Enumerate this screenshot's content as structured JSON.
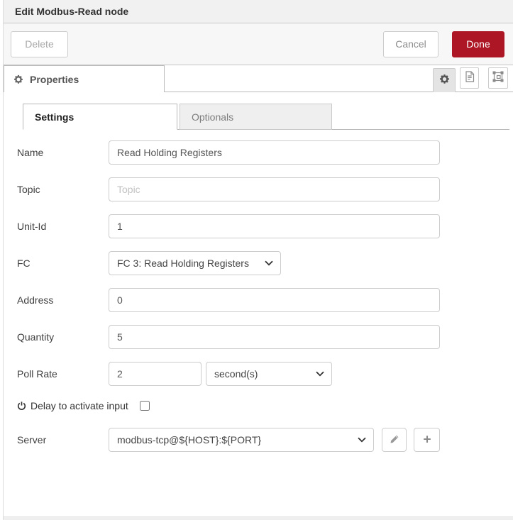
{
  "dialog": {
    "title": "Edit Modbus-Read node"
  },
  "toolbar": {
    "delete_label": "Delete",
    "cancel_label": "Cancel",
    "done_label": "Done"
  },
  "editor_tabs": {
    "properties_label": "Properties",
    "icon_tabs": [
      "gear-icon",
      "document-icon",
      "appearance-icon"
    ]
  },
  "subtabs": {
    "settings_label": "Settings",
    "optionals_label": "Optionals"
  },
  "form": {
    "name": {
      "label": "Name",
      "value": "Read Holding Registers"
    },
    "topic": {
      "label": "Topic",
      "placeholder": "Topic"
    },
    "unit_id": {
      "label": "Unit-Id",
      "value": "1"
    },
    "fc": {
      "label": "FC",
      "value": "FC 3: Read Holding Registers"
    },
    "address": {
      "label": "Address",
      "value": "0"
    },
    "quantity": {
      "label": "Quantity",
      "value": "5"
    },
    "poll_rate": {
      "label": "Poll Rate",
      "value": "2",
      "unit_value": "second(s)"
    },
    "delay": {
      "label": "Delay to activate input",
      "checked": false
    },
    "server": {
      "label": "Server",
      "value": "modbus-tcp@${HOST}:${PORT}"
    }
  },
  "colors": {
    "accent_red": "#AD1625",
    "header_bg": "#f1f1f1",
    "active_tile_bg": "#e4e4e4"
  }
}
